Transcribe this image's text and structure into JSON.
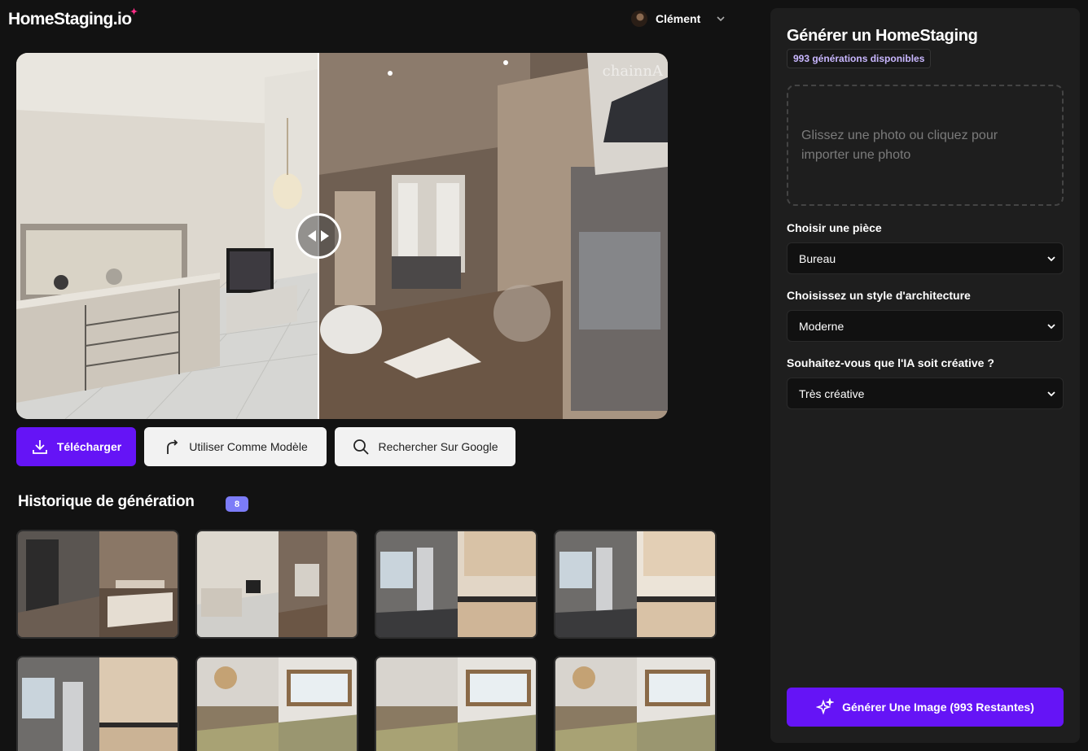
{
  "header": {
    "logo_text": "HomeStaging.io",
    "user_name": "Clément"
  },
  "viewer": {
    "watermark": "chainnA"
  },
  "actions": {
    "download_label": "Télécharger",
    "use_as_model_label": "Utiliser Comme Modèle",
    "google_search_label": "Rechercher Sur Google"
  },
  "history": {
    "title": "Historique de génération",
    "count": "8"
  },
  "panel": {
    "title": "Générer un HomeStaging",
    "generations_available": "993 générations disponibles",
    "dropzone_text": "Glissez une photo ou cliquez pour importer une photo",
    "room_label": "Choisir une pièce",
    "room_value": "Bureau",
    "style_label": "Choisissez un style d'architecture",
    "style_value": "Moderne",
    "creativity_label": "Souhaitez-vous que l'IA soit créative ?",
    "creativity_value": "Très créative",
    "generate_label": "Générer Une Image (993 Restantes)"
  },
  "colors": {
    "accent": "#6514f6",
    "badge": "#7c7cf8",
    "background": "#121212",
    "panel": "#1e1e1e"
  }
}
